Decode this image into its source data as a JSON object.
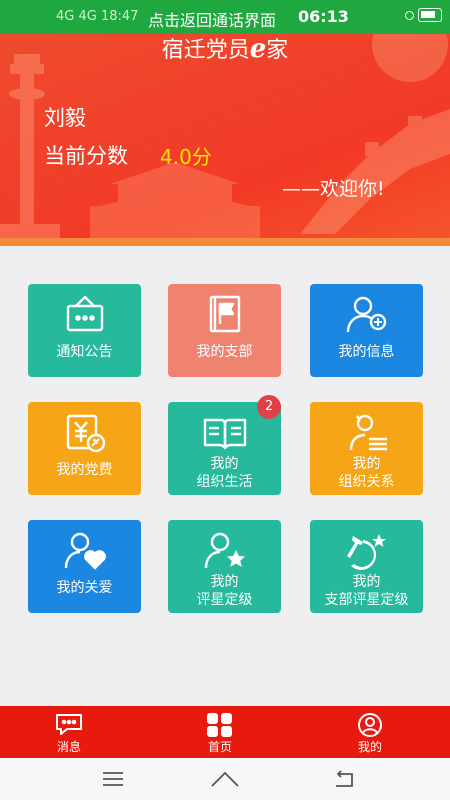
{
  "status_bar": {
    "left_text": "4G 4G 18:47",
    "center_text": "点击返回通话界面",
    "time": "06:13"
  },
  "banner": {
    "app_title_prefix": "宿迁党员",
    "app_title_e": "e",
    "app_title_suffix": "家",
    "user_name": "刘毅",
    "score_label": "当前分数",
    "score_value": "4.0分",
    "welcome": "——欢迎你!"
  },
  "tiles": [
    {
      "id": "notice",
      "line1": "通知公告",
      "line2": "",
      "color": "#26b99c",
      "icon": "notice-board-icon"
    },
    {
      "id": "branch",
      "line1": "我的支部",
      "line2": "",
      "color": "#f0836f",
      "icon": "flag-book-icon"
    },
    {
      "id": "info",
      "line1": "我的信息",
      "line2": "",
      "color": "#1c87e0",
      "icon": "user-info-icon"
    },
    {
      "id": "dues",
      "line1": "我的党费",
      "line2": "",
      "color": "#f6a516",
      "icon": "yuan-party-icon"
    },
    {
      "id": "org_life",
      "line1": "我的",
      "line2": "组织生活",
      "color": "#26b99c",
      "icon": "open-book-icon",
      "badge": "2"
    },
    {
      "id": "org_relation",
      "line1": "我的",
      "line2": "组织关系",
      "color": "#f6a516",
      "icon": "users-list-icon"
    },
    {
      "id": "care",
      "line1": "我的关爱",
      "line2": "",
      "color": "#1c87e0",
      "icon": "user-heart-icon"
    },
    {
      "id": "rating",
      "line1": "我的",
      "line2": "评星定级",
      "color": "#26b99c",
      "icon": "user-star-icon"
    },
    {
      "id": "branch_rating",
      "line1": "我的",
      "line2": "支部评星定级",
      "color": "#26b99c",
      "icon": "hammer-sickle-star-icon"
    }
  ],
  "tabbar": {
    "messages": "消息",
    "home": "首页",
    "mine": "我的"
  }
}
